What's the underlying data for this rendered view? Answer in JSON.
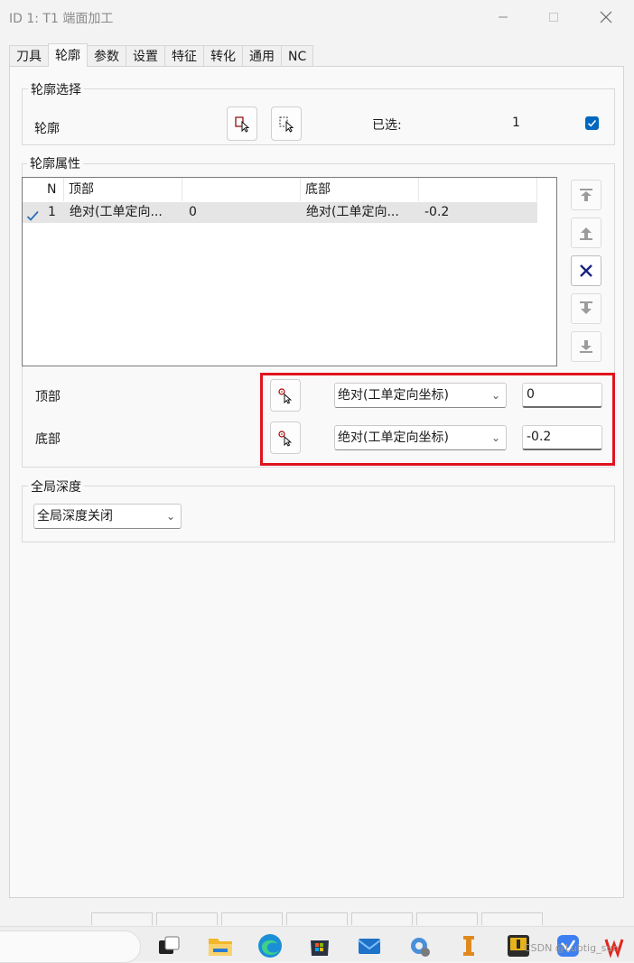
{
  "window": {
    "title": "ID 1: T1 端面加工",
    "minimize_icon": "minimize-icon",
    "maximize_icon": "maximize-icon",
    "close_icon": "close-icon"
  },
  "tabs": [
    {
      "label": "刀具",
      "active": false
    },
    {
      "label": "轮廓",
      "active": true
    },
    {
      "label": "参数",
      "active": false
    },
    {
      "label": "设置",
      "active": false
    },
    {
      "label": "特征",
      "active": false
    },
    {
      "label": "转化",
      "active": false
    },
    {
      "label": "通用",
      "active": false
    },
    {
      "label": "NC",
      "active": false
    }
  ],
  "contour_selection": {
    "legend": "轮廓选择",
    "label": "轮廓",
    "selected_label": "已选:",
    "selected_count": "1",
    "checkbox_checked": true
  },
  "contour_properties": {
    "legend": "轮廓属性",
    "columns": [
      "N",
      "顶部",
      "",
      "底部",
      ""
    ],
    "rows": [
      {
        "checked": true,
        "n": "1",
        "top": "绝对(工单定向...",
        "top_value": "0",
        "bottom": "绝对(工单定向...",
        "bottom_value": "-0.2"
      }
    ],
    "side_buttons": [
      "move-to-top-icon",
      "move-up-icon",
      "delete-x-icon",
      "move-down-icon",
      "move-to-bottom-icon"
    ],
    "top_label": "顶部",
    "bottom_label": "底部",
    "top_mode": "绝对(工单定向坐标)",
    "top_value": "0",
    "bottom_mode": "绝对(工单定向坐标)",
    "bottom_value": "-0.2"
  },
  "global_depth": {
    "legend": "全局深度",
    "mode": "全局深度关闭"
  },
  "taskbar": {
    "watermark": "CSDN @Lubtig_sun"
  },
  "colors": {
    "accent": "#0067c0",
    "highlight_box": "#e0141e"
  }
}
